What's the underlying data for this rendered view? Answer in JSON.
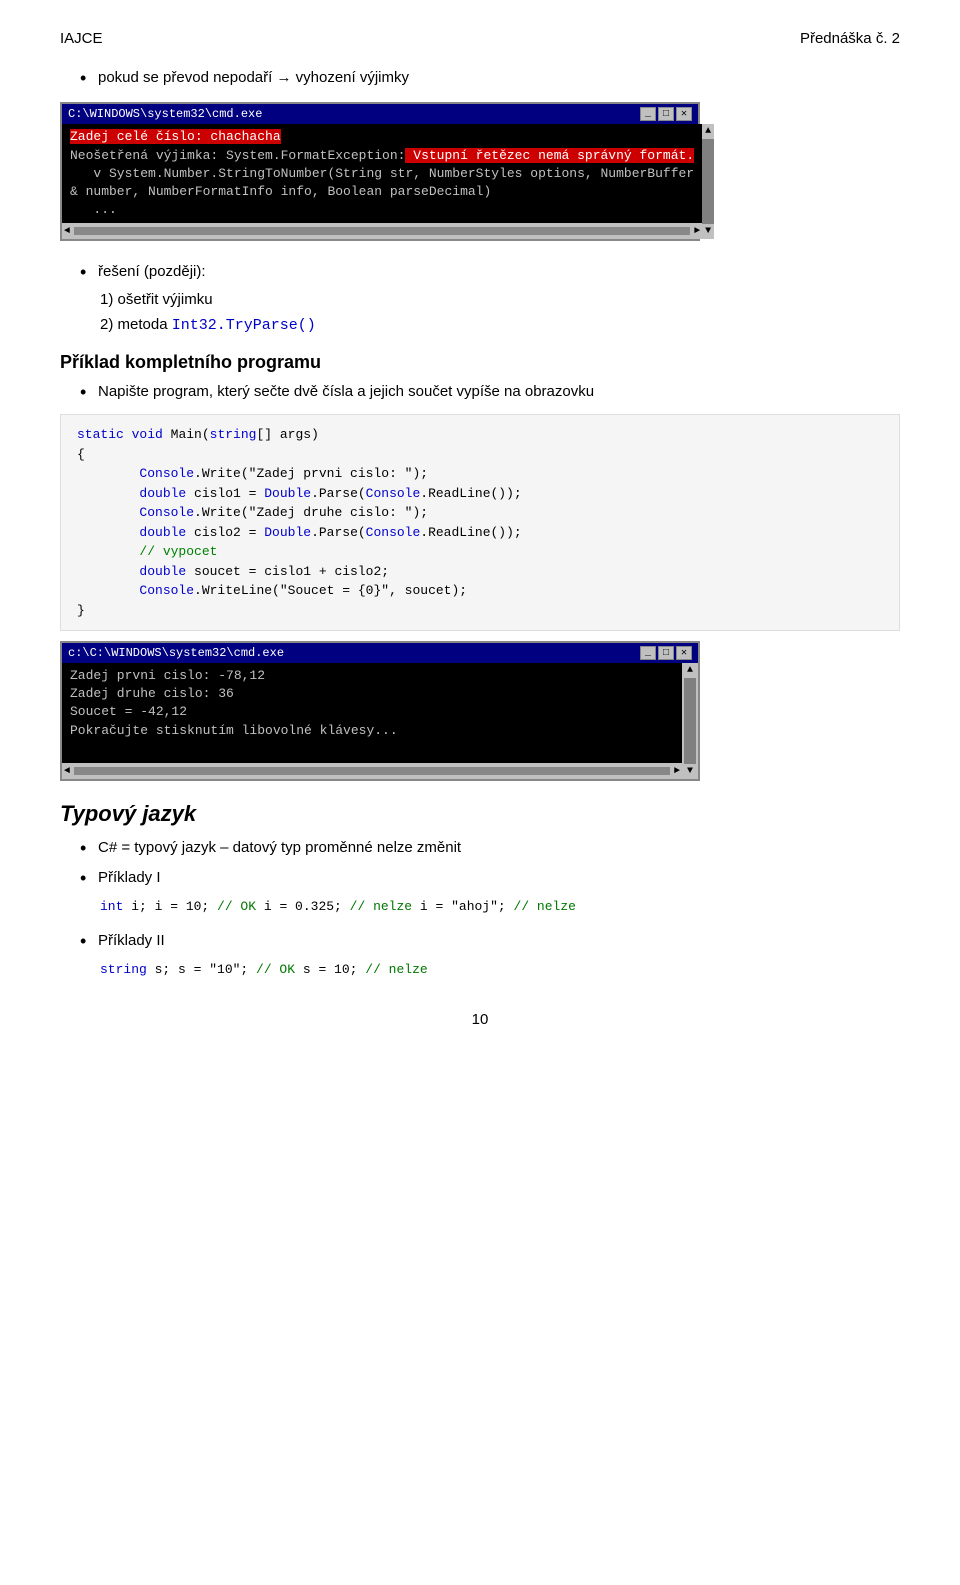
{
  "header": {
    "left": "IAJCE",
    "right": "Přednáška č. 2"
  },
  "intro_bullet": "pokud se převod nepodaří → vyhození výjimky",
  "cmd1": {
    "titlebar": "C:\\WINDOWS\\system32\\cmd.exe",
    "input_label": "Zadej celé číslo: chachacha",
    "error_line1": "Neošetřená výjimka: System.FormatException:",
    "error_highlight": " Vstupní řetězec nemá správný formát.",
    "stack1": "   v System.Number.StringToNumber(String str, NumberStyles options, NumberBuffer",
    "stack2": "& number, NumberFormatInfo info, Boolean parseDecimal)"
  },
  "reseni_heading": "řešení (později):",
  "numbered_items": [
    "ošetřit výjimku",
    "metoda Int32.TryParse()"
  ],
  "priklad_heading": "Příklad kompletního programu",
  "priklad_bullet": "Napište program, který sečte dvě čísla a jejich součet vypíše na obrazovku",
  "code_main": "static void Main(string[] args)\n{\n        Console.Write(\"Zadej prvni cislo: \");\n        double cislo1 = Double.Parse(Console.ReadLine());\n        Console.Write(\"Zadej druhe cislo: \");\n        double cislo2 = Double.Parse(Console.ReadLine());\n        // vypocet\n        double soucet = cislo1 + cislo2;\n        Console.WriteLine(\"Soucet = {0}\", soucet);\n}",
  "cmd2": {
    "titlebar": "c:\\C:\\WINDOWS\\system32\\cmd.exe",
    "line1": "Zadej prvni cislo: -78,12",
    "line2": "Zadej druhe cislo: 36",
    "line3": "Soucet = -42,12",
    "line4": "Pokračujte stisknutím libovolné klávesy..."
  },
  "typovy_heading": "Typový jazyk",
  "typovy_bullets": [
    "C# = typový jazyk – datový typ proměnné nelze změnit",
    "Příklady I"
  ],
  "priklady1_code": "int i;\ni = 10;         // OK\ni = 0.325;      // nelze\ni = \"ahoj\";     // nelze",
  "priklady2_heading": "Příklady II",
  "priklady2_code": "string s;\ns = \"10\";       // OK\ns = 10;         // nelze",
  "page_number": "10"
}
